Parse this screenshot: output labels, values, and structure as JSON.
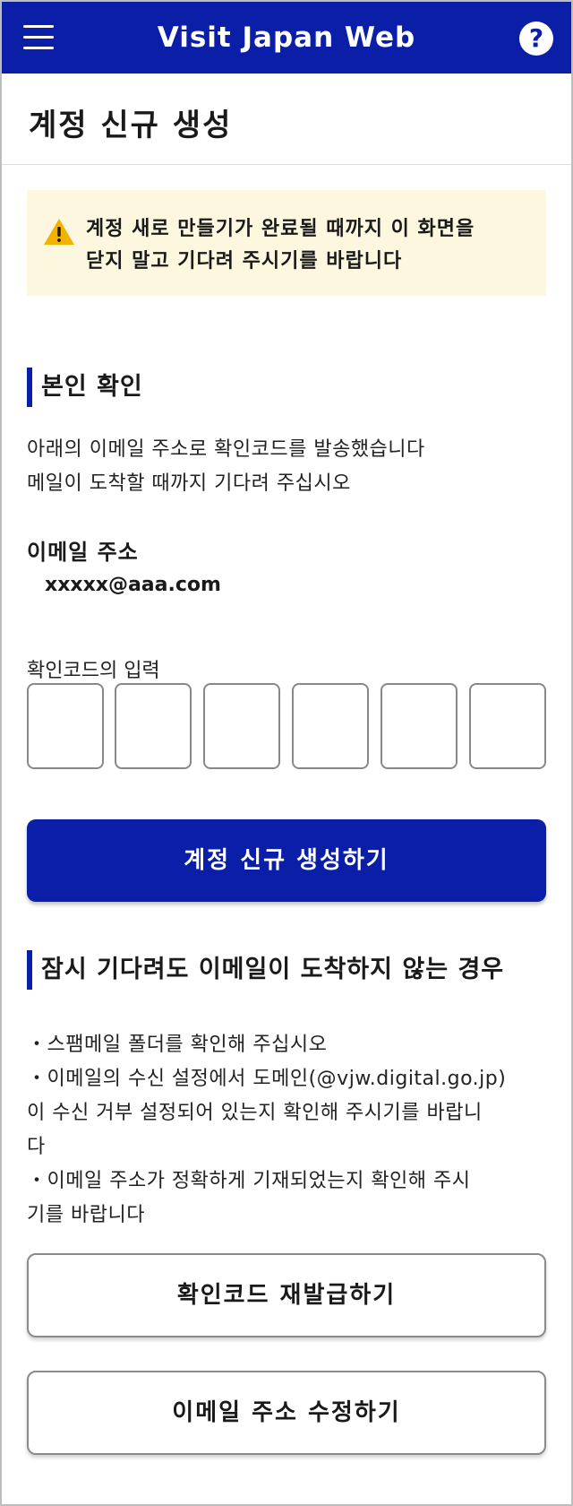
{
  "header": {
    "title": "Visit Japan Web",
    "help_label": "?",
    "menu_icon": "hamburger-menu-icon"
  },
  "page": {
    "title": "계정 신규 생성"
  },
  "notice": {
    "icon": "warning-triangle-icon",
    "line1": "계정 새로 만들기가 완료될 때까지 이 화면을",
    "line2": "닫지 말고 기다려 주시기를 바랍니다"
  },
  "identity": {
    "heading": "본인 확인",
    "line1": "아래의 이메일 주소로 확인코드를 발송했습니다",
    "line2": "메일이 도착할 때까지 기다려 주십시오",
    "email_label": "이메일 주소",
    "email_value": "xxxxx@aaa.com",
    "code_label": "확인코드의 입력",
    "code_digits": [
      "",
      "",
      "",
      "",
      "",
      ""
    ]
  },
  "actions": {
    "create_label": "계정 신규 생성하기",
    "resend_label": "확인코드 재발급하기",
    "edit_email_label": "이메일 주소 수정하기"
  },
  "help": {
    "heading": "잠시 기다려도 이메일이 도착하지 않는 경우",
    "tip1": "・스팸메일 폴더를 확인해 주십시오",
    "tip2_line1": "・이메일의 수신 설정에서 도메인(@vjw.digital.go.jp)",
    "tip2_line2": "이 수신 거부 설정되어 있는지 확인해 주시기를 바랍니",
    "tip2_line3": "다",
    "tip3_line1": "・이메일 주소가 정확하게 기재되었는지 확인해 주시",
    "tip3_line2": "기를 바랍니다"
  },
  "colors": {
    "brand": "#0a1ea8",
    "notice_bg": "#fdf7e0",
    "warning": "#f2b200"
  }
}
